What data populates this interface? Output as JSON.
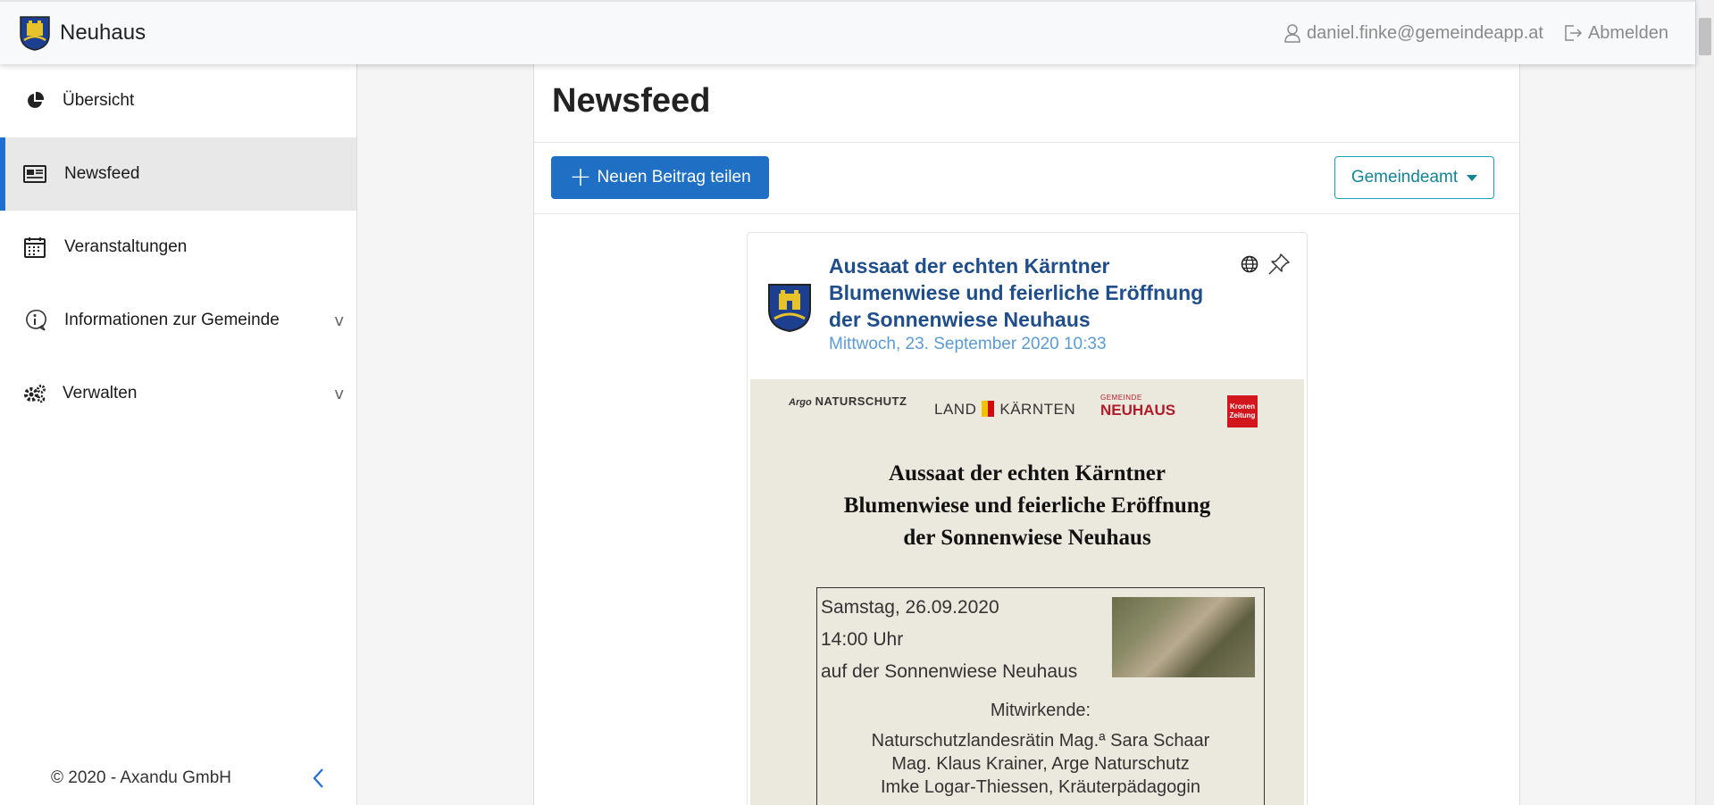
{
  "header": {
    "app_name": "Neuhaus",
    "user_email": "daniel.finke@gemeindeapp.at",
    "logout_label": "Abmelden"
  },
  "sidebar": {
    "items": [
      {
        "label": "Übersicht",
        "icon": "pie-chart-icon"
      },
      {
        "label": "Newsfeed",
        "icon": "newspaper-icon",
        "active": true
      },
      {
        "label": "Veranstaltungen",
        "icon": "calendar-icon"
      },
      {
        "label": "Informationen zur Gemeinde",
        "icon": "info-bubble-icon",
        "chevron": "v"
      },
      {
        "label": "Verwalten",
        "icon": "gears-icon",
        "chevron": "v"
      }
    ],
    "footer": "© 2020 - Axandu GmbH"
  },
  "main": {
    "title": "Newsfeed",
    "new_post_label": "Neuen Beitrag teilen",
    "filter_label": "Gemeindeamt"
  },
  "post": {
    "title": "Aussaat der echten Kärntner Blumenwiese und feierliche Eröffnung der Sonnenwiese Neuhaus",
    "date": "Mittwoch, 23. September 2020 10:33",
    "poster": {
      "logo_argo": "Argo",
      "logo_naturschutz": "NATURSCHUTZ",
      "logo_land": "LAND",
      "logo_kaernten": "KÄRNTEN",
      "logo_gemeinde_small": "GEMEINDE",
      "logo_gemeinde": "NEUHAUS",
      "logo_krone": "Kronen Zeitung",
      "title_line1": "Aussaat der echten Kärntner",
      "title_line2": "Blumenwiese und feierliche Eröffnung",
      "title_line3": "der Sonnenwiese Neuhaus",
      "date": "Samstag, 26.09.2020",
      "time": "14:00 Uhr",
      "location": "auf der Sonnenwiese Neuhaus",
      "participants_heading": "Mitwirkende:",
      "participant1": "Naturschutzlandesrätin Mag.ª Sara Schaar",
      "participant2": "Mag. Klaus Krainer, Arge Naturschutz",
      "participant3": "Imke Logar-Thiessen, Kräuterpädagogin"
    }
  },
  "colors": {
    "primary": "#1f6fc5",
    "accent_active": "#1f6fd1",
    "post_title": "#1f4e8a",
    "post_date": "#5b9bd5",
    "outline": "#17a2b8"
  }
}
